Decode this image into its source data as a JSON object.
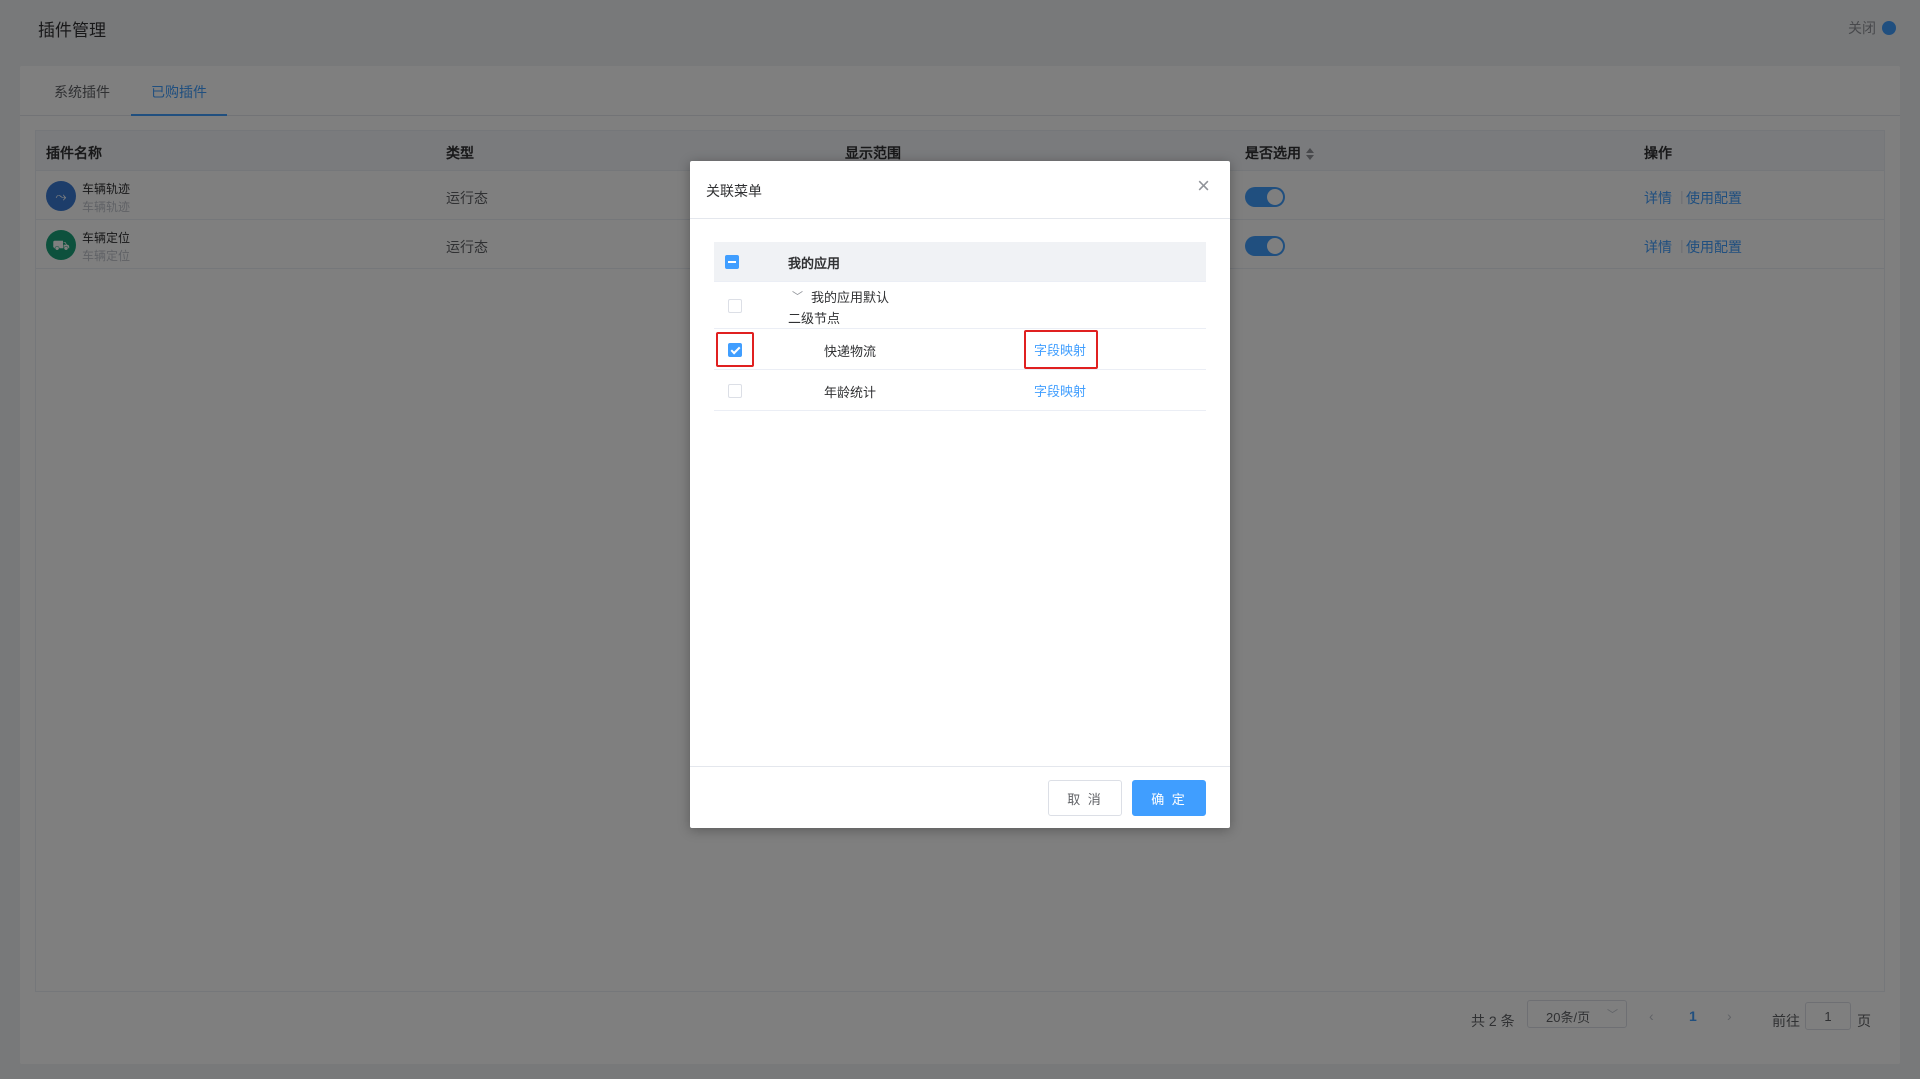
{
  "header": {
    "title": "插件管理",
    "close_label": "关闭"
  },
  "tabs": [
    {
      "label": "系统插件",
      "active": false
    },
    {
      "label": "已购插件",
      "active": true
    }
  ],
  "table": {
    "columns": [
      "插件名称",
      "类型",
      "显示范围",
      "是否选用",
      "操作"
    ],
    "rows": [
      {
        "name": "车辆轨迹",
        "sub": "车辆轨迹",
        "icon": "route-icon",
        "icon_color": "#3a7bd5",
        "type": "运行态",
        "enabled": true,
        "actions": {
          "detail": "详情",
          "config": "使用配置"
        }
      },
      {
        "name": "车辆定位",
        "sub": "车辆定位",
        "icon": "truck-icon",
        "icon_color": "#1aa37a",
        "type": "运行态",
        "enabled": true,
        "actions": {
          "detail": "详情",
          "config": "使用配置"
        }
      }
    ]
  },
  "pagination": {
    "total": "共 2 条",
    "page_size": "20条/页",
    "current_page": "1",
    "goto_label": "前往",
    "goto_value": "1",
    "page_unit": "页"
  },
  "modal": {
    "title": "关联菜单",
    "tree": {
      "root": {
        "label": "我的应用",
        "state": "indeterminate"
      },
      "group": {
        "line1": "我的应用默认",
        "line2": "二级节点",
        "checked": false
      },
      "items": [
        {
          "label": "快递物流",
          "checked": true,
          "link": "字段映射"
        },
        {
          "label": "年龄统计",
          "checked": false,
          "link": "字段映射"
        }
      ]
    },
    "cancel_label": "取 消",
    "ok_label": "确 定"
  },
  "colors": {
    "primary": "#409eff",
    "highlight": "#e02020"
  }
}
